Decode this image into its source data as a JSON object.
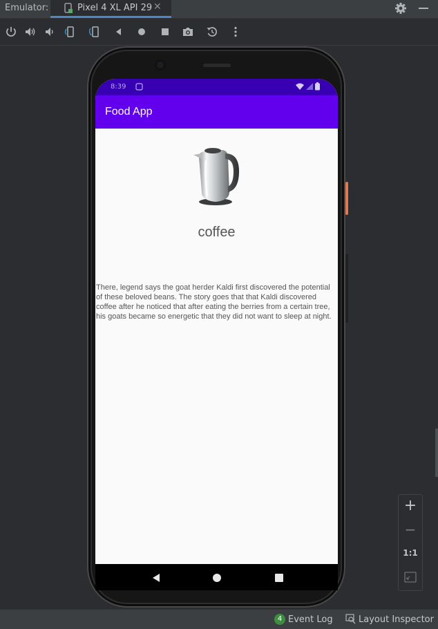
{
  "titlebar": {
    "label": "Emulator:",
    "tab_label": "Pixel 4 XL API 29",
    "close_glyph": "✕"
  },
  "toolbar": {
    "icons": [
      "power-icon",
      "volume-up-icon",
      "volume-down-icon",
      "rotate-left-icon",
      "rotate-right-icon",
      "back-icon",
      "home-icon",
      "overview-icon",
      "screenshot-icon",
      "snapshot-icon",
      "more-icon"
    ]
  },
  "phone": {
    "status_time": "8:39",
    "app_title": "Food App",
    "food_name": "coffee",
    "description": "There, legend says the goat herder Kaldi first discovered the potential of these beloved beans. The story goes that that Kaldi discovered coffee after he noticed that after eating the berries from a certain tree, his goats became so energetic that they did not want to sleep at night.",
    "colors": {
      "status_bar": "#3700b3",
      "app_bar": "#6200ee",
      "screen_bg": "#fafafa"
    }
  },
  "zoom": {
    "plus": "+",
    "minus": "−",
    "one_to_one": "1:1"
  },
  "bottombar": {
    "event_count": "4",
    "event_log": "Event Log",
    "layout_inspector": "Layout Inspector"
  }
}
